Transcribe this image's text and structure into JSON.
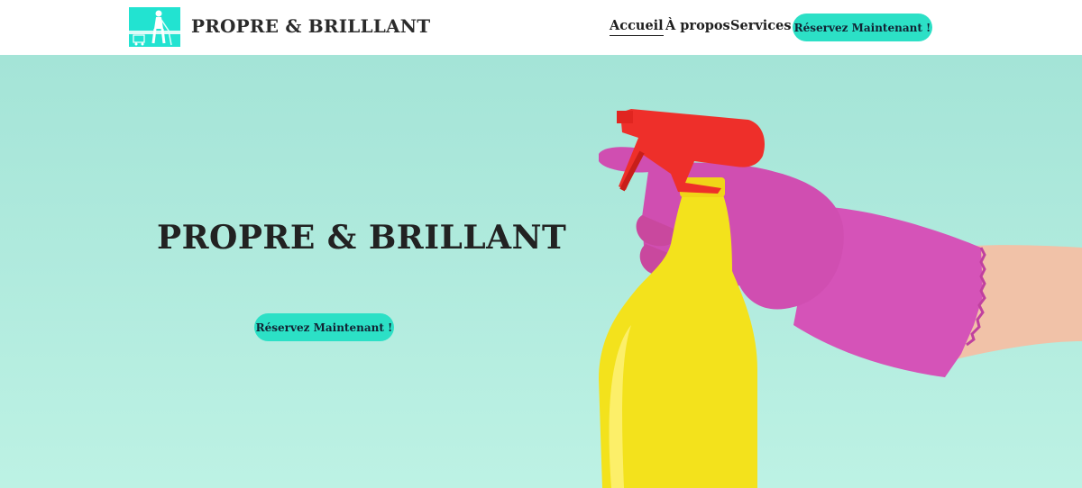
{
  "header": {
    "site_title": "PROPRE & BRILLLANT",
    "logo_icon": "cleaning-person-logo-icon",
    "nav": {
      "home": "Accueil",
      "about": "À propos",
      "services": "Services",
      "cta": "Réservez Maintenant !"
    }
  },
  "hero": {
    "title": "PROPRE & BRILLANT",
    "cta": "Réservez Maintenant !",
    "image_icon": "spray-bottle-glove-photo"
  },
  "colors": {
    "accent": "#2ce0c6",
    "logo_bg": "#22e3d1",
    "hero_bg": "#a8e6d9",
    "glove": "#d64fb7",
    "bottle": "#f5e21a",
    "trigger": "#f0302a"
  }
}
